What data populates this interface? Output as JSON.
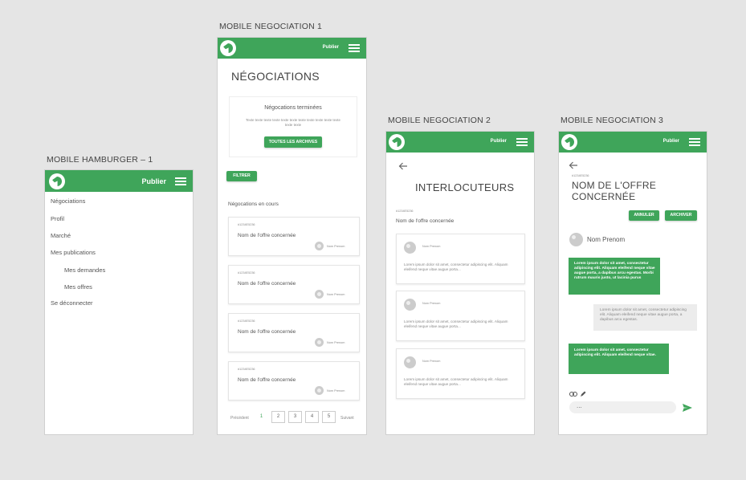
{
  "frames": {
    "hamburger": {
      "title": "MOBILE HAMBURGER – 1",
      "publish": "Publier",
      "menu": [
        "Négociations",
        "Profil",
        "Marché",
        "Mes publications",
        "Mes demandes",
        "Mes offres",
        "Se déconnecter"
      ]
    },
    "nego1": {
      "title": "MOBILE NEGOCIATION 1",
      "publish": "Publier",
      "heading": "NÉGOCIATIONS",
      "done_card": {
        "title": "Négocations terminées",
        "text": "Texte texte texte texte texte texte texte texte texte texte texte texte texte",
        "button": "TOUTES LES ARCHIVES"
      },
      "filter": "FILTRER",
      "ongoing_title": "Négocations en cours",
      "items": [
        {
          "id": "#1234E5236",
          "name": "Nom de l'offre concernée",
          "person": "Nom Prenom"
        },
        {
          "id": "#1234E5236",
          "name": "Nom de l'offre concernée",
          "person": "Nom Prenom"
        },
        {
          "id": "#1234E5236",
          "name": "Nom de l'offre concernée",
          "person": "Nom Prenom"
        },
        {
          "id": "#1234E5236",
          "name": "Nom de l'offre concernée",
          "person": "Nom Prenom"
        }
      ],
      "pagination": {
        "prev": "Précédent",
        "pages": [
          "1",
          "2",
          "3",
          "4",
          "5"
        ],
        "next": "Suivant"
      }
    },
    "nego2": {
      "title": "MOBILE NEGOCIATION 2",
      "publish": "Publier",
      "heading": "INTERLOCUTEURS",
      "ref": "#1234E5236",
      "offer": "Nom de l'offre concernée",
      "contacts": [
        {
          "name": "Nom Prenom",
          "text": "Lorem ipsum dolor sit amet, consectetur adipiscing elit. Aliquam eleifend neque vitae augue porta..."
        },
        {
          "name": "Nom Prenom",
          "text": "Lorem ipsum dolor sit amet, consectetur adipiscing elit. Aliquam eleifend neque vitae augue porta..."
        },
        {
          "name": "Nom Prenom",
          "text": "Lorem ipsum dolor sit amet, consectetur adipiscing elit. Aliquam eleifend neque vitae augue porta..."
        }
      ]
    },
    "nego3": {
      "title": "MOBILE NEGOCIATION 3",
      "publish": "Publier",
      "ref": "#1234E5236",
      "heading_line1": "NOM DE L'OFFRE",
      "heading_line2": "CONCERNÉE",
      "cancel": "ANNULER",
      "archive": "ARCHIVER",
      "person": "Nom Prenom",
      "messages": [
        {
          "side": "left",
          "text": "Lorem ipsum dolor sit amet, consectetur adipiscing elit. Aliquam eleifend neque vitae augue porta, a dapibus arcu egestas. Morbi rutrum mauris justo, ut lacinia purus"
        },
        {
          "side": "right",
          "text": "Lorem ipsum dolor sit amet, consectetur adipiscing elit. Aliquam eleifend neque vitae augue porta, a dapibus arcu egestas."
        },
        {
          "side": "left",
          "text": "Lorem ipsum dolor sit amet, consectetur adipiscing elit. Aliquam eleifend neque vitae."
        }
      ],
      "input_value": "..."
    }
  },
  "colors": {
    "accent": "#3fa55a",
    "background": "#e5e5e5"
  }
}
